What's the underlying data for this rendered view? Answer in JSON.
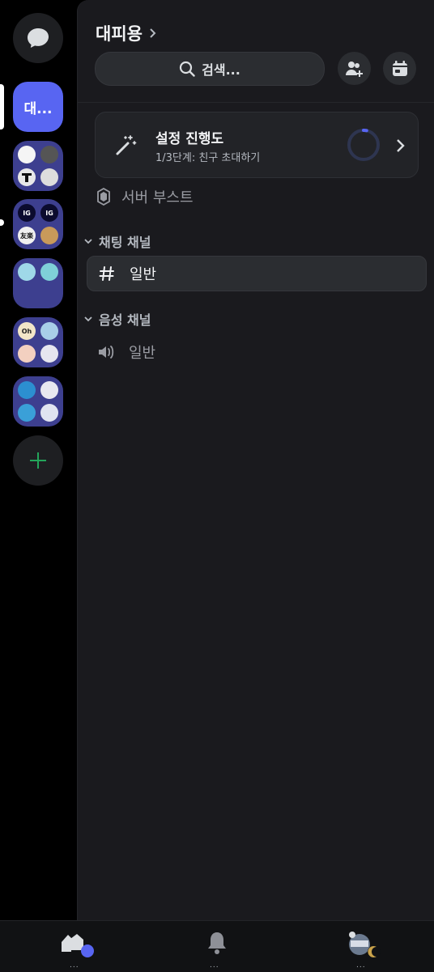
{
  "server_rail": {
    "dm_icon": "chat-bubble-icon",
    "selected_server_label": "대...",
    "folders": [
      {
        "minis": [
          "",
          "",
          "",
          ""
        ]
      },
      {
        "minis": [
          "IG",
          "IG",
          "友楽",
          ""
        ]
      },
      {
        "minis": [
          "",
          "",
          "",
          ""
        ]
      },
      {
        "minis": [
          "Oh",
          "",
          "",
          ""
        ]
      },
      {
        "minis": [
          "",
          "",
          "",
          ""
        ]
      }
    ],
    "add_server_icon": "plus-icon"
  },
  "header": {
    "server_name": "대피용",
    "chevron": "›",
    "search_placeholder": "검색..."
  },
  "setup_progress": {
    "title": "설정 진행도",
    "subtitle": "1/3단계: 친구 초대하기",
    "progress": 0.0333
  },
  "boost": {
    "label": "서버 부스트"
  },
  "categories": [
    {
      "label": "채팅 채널",
      "channels": [
        {
          "label": "일반",
          "type": "text"
        }
      ]
    },
    {
      "label": "음성 채널",
      "channels": [
        {
          "label": "일반",
          "type": "voice"
        }
      ]
    }
  ],
  "bottom_nav": {
    "home_dots": "...",
    "notifications_dots": "...",
    "profile_dots": "..."
  },
  "colors": {
    "accent": "#5865f2",
    "add_green": "#23a55a",
    "panel_bg": "#1a1a1e"
  }
}
